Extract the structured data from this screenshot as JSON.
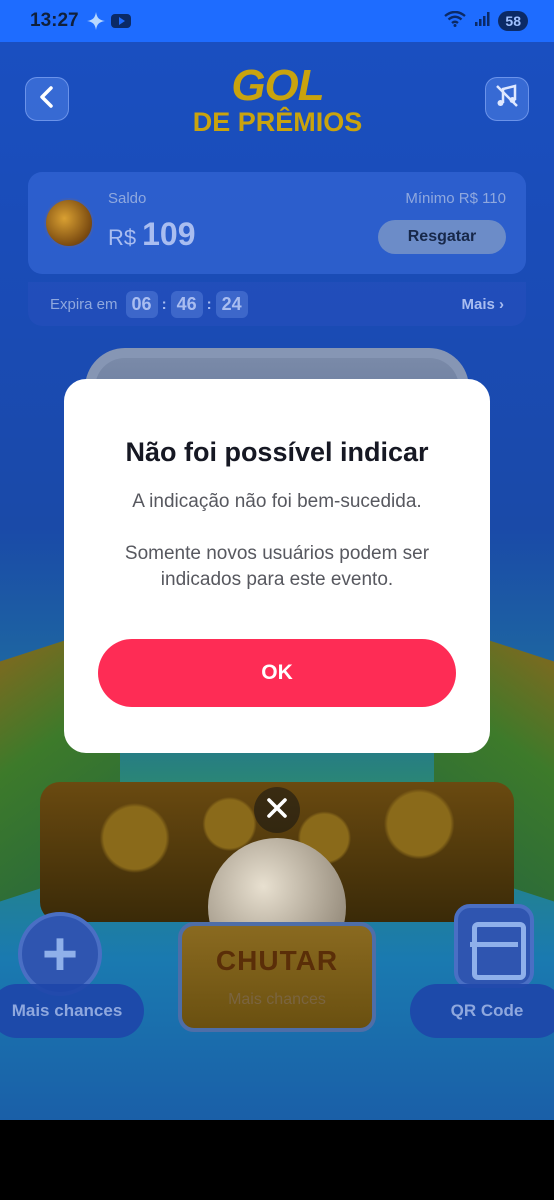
{
  "status_bar": {
    "time": "13:27",
    "battery": "58"
  },
  "game": {
    "logo_line1": "GOL",
    "logo_line2": "DE PRÊMIOS",
    "balance": {
      "label": "Saldo",
      "currency": "R$",
      "value": "109",
      "minimum": "Mínimo  R$ 110",
      "redeem_label": "Resgatar"
    },
    "expiry": {
      "label": "Expira em",
      "hours": "06",
      "minutes": "46",
      "seconds": "24",
      "more_label": "Mais ›"
    },
    "kick_button": {
      "label": "CHUTAR",
      "sub_label": "Mais chances"
    },
    "left_action_label": "Mais chances",
    "right_action_label": "QR Code"
  },
  "dialog": {
    "title": "Não foi possível indicar",
    "message1": "A indicação não foi bem-sucedida.",
    "message2": "Somente novos usuários podem ser indicados para este evento.",
    "ok_label": "OK"
  },
  "icons": {
    "back": "chevron-left-icon",
    "music": "music-off-icon",
    "close": "close-icon",
    "plus": "plus-icon",
    "qr": "qr-scan-icon"
  },
  "colors": {
    "status_bar": "#1e6cff",
    "ok_button": "#fe2c55",
    "dialog_bg": "#ffffff",
    "title_text": "#161823"
  }
}
